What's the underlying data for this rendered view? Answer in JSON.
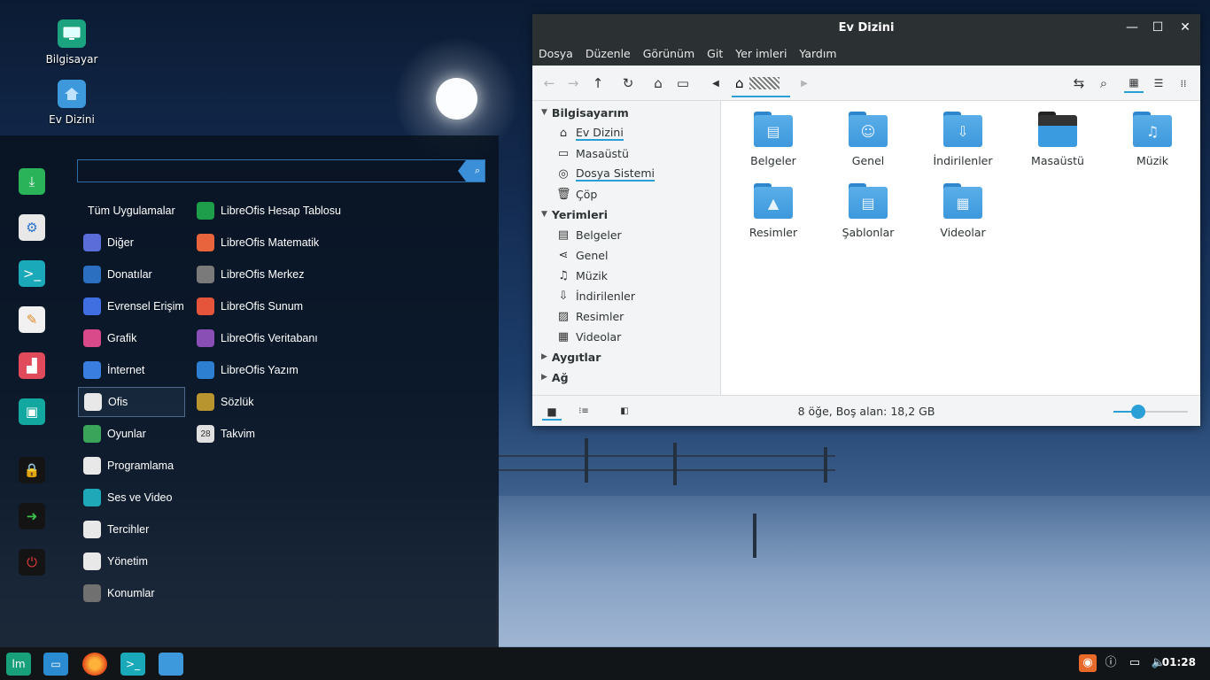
{
  "desktop": {
    "icons": [
      {
        "label": "Bilgisayar"
      },
      {
        "label": "Ev Dizini"
      }
    ]
  },
  "menu": {
    "search": {
      "value": "",
      "placeholder": ""
    },
    "categories": [
      {
        "label": "Tüm Uygulamalar"
      },
      {
        "label": "Diğer"
      },
      {
        "label": "Donatılar"
      },
      {
        "label": "Evrensel Erişim"
      },
      {
        "label": "Grafik"
      },
      {
        "label": "İnternet"
      },
      {
        "label": "Ofis"
      },
      {
        "label": "Oyunlar"
      },
      {
        "label": "Programlama"
      },
      {
        "label": "Ses ve Video"
      },
      {
        "label": "Tercihler"
      },
      {
        "label": "Yönetim"
      },
      {
        "label": "Konumlar"
      }
    ],
    "active_category": "Ofis",
    "apps": [
      {
        "label": "LibreOfis Hesap Tablosu",
        "color": "#1e9e4a"
      },
      {
        "label": "LibreOfis Matematik",
        "color": "#e8643c"
      },
      {
        "label": "LibreOfis Merkez",
        "color": "#7a7a7a"
      },
      {
        "label": "LibreOfis Sunum",
        "color": "#e5553b"
      },
      {
        "label": "LibreOfis Veritabanı",
        "color": "#8a4fb5"
      },
      {
        "label": "LibreOfis Yazım",
        "color": "#2d7fd1"
      },
      {
        "label": "Sözlük",
        "color": "#b8952f"
      },
      {
        "label": "Takvim",
        "color": "#e0e0e0",
        "badge": "28"
      }
    ]
  },
  "file_manager": {
    "title": "Ev Dizini",
    "menubar": [
      "Dosya",
      "Düzenle",
      "Görünüm",
      "Git",
      "Yer imleri",
      "Yardım"
    ],
    "sidebar": {
      "sections": [
        {
          "label": "Bilgisayarım"
        },
        {
          "label": "Yerimleri"
        },
        {
          "label": "Aygıtlar"
        },
        {
          "label": "Ağ"
        }
      ],
      "computer_items": [
        {
          "label": "Ev Dizini",
          "icon": "home-icon"
        },
        {
          "label": "Masaüstü",
          "icon": "desktop-icon"
        },
        {
          "label": "Dosya Sistemi",
          "icon": "drive-icon"
        },
        {
          "label": "Çöp",
          "icon": "trash-icon"
        }
      ],
      "bookmark_items": [
        {
          "label": "Belgeler",
          "icon": "document-icon"
        },
        {
          "label": "Genel",
          "icon": "share-icon"
        },
        {
          "label": "Müzik",
          "icon": "music-icon"
        },
        {
          "label": "İndirilenler",
          "icon": "download-icon"
        },
        {
          "label": "Resimler",
          "icon": "image-icon"
        },
        {
          "label": "Videolar",
          "icon": "video-icon"
        }
      ]
    },
    "items": [
      {
        "label": "Belgeler",
        "icon": "document-folder-icon"
      },
      {
        "label": "Genel",
        "icon": "user-folder-icon"
      },
      {
        "label": "İndirilenler",
        "icon": "download-folder-icon"
      },
      {
        "label": "Masaüstü",
        "icon": "desktop-folder-icon"
      },
      {
        "label": "Müzik",
        "icon": "music-folder-icon"
      },
      {
        "label": "Resimler",
        "icon": "image-folder-icon"
      },
      {
        "label": "Şablonlar",
        "icon": "template-folder-icon"
      },
      {
        "label": "Videolar",
        "icon": "video-folder-icon"
      }
    ],
    "status": "8 öğe, Boş alan: 18,2 GB",
    "zoom_fraction": 0.33
  },
  "taskbar": {
    "clock": "01:28"
  },
  "colors": {
    "accent": "#2a9fd6",
    "titlebar": "#2b3033",
    "folder": "#3d98dc"
  }
}
